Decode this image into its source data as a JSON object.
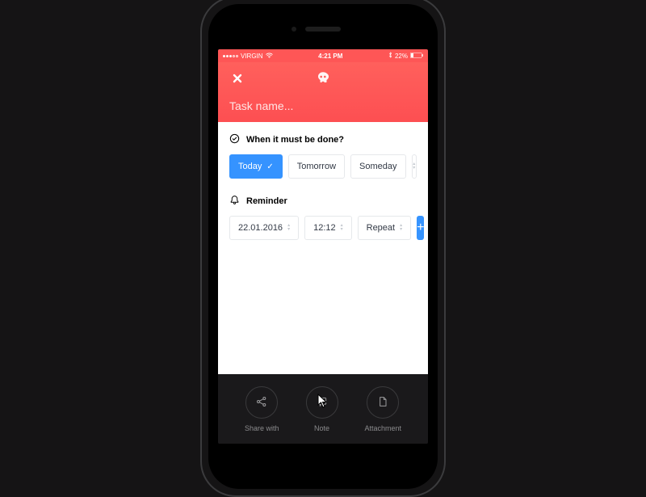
{
  "status": {
    "carrier": "VIRGIN",
    "time": "4:21 PM",
    "battery": "22%"
  },
  "header": {
    "task_name_placeholder": "Task name..."
  },
  "when": {
    "label": "When it must be done?",
    "option_today": "Today",
    "option_tomorrow": "Tomorrow",
    "option_someday": "Someday"
  },
  "reminder": {
    "label": "Reminder",
    "date": "22.01.2016",
    "time": "12:12",
    "repeat": "Repeat"
  },
  "footer": {
    "share": "Share with",
    "note": "Note",
    "attachment": "Attachment"
  }
}
